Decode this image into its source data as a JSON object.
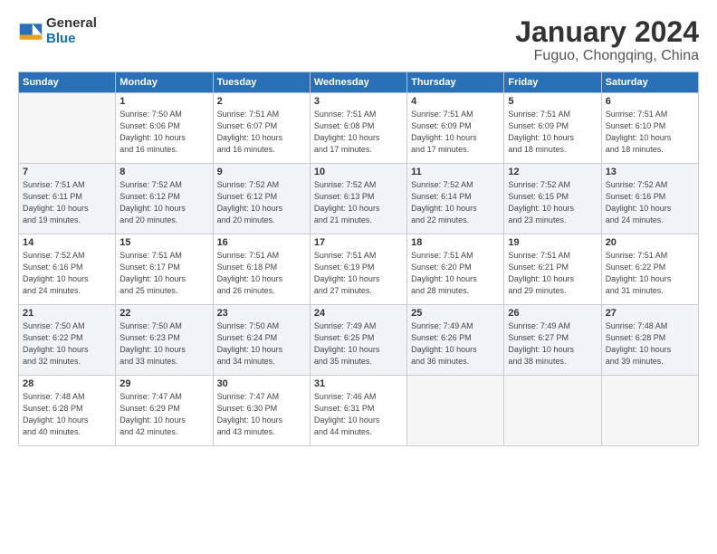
{
  "logo": {
    "text1": "General",
    "text2": "Blue"
  },
  "title": "January 2024",
  "subtitle": "Fuguo, Chongqing, China",
  "days_of_week": [
    "Sunday",
    "Monday",
    "Tuesday",
    "Wednesday",
    "Thursday",
    "Friday",
    "Saturday"
  ],
  "weeks": [
    [
      {
        "day": "",
        "info": ""
      },
      {
        "day": "1",
        "info": "Sunrise: 7:50 AM\nSunset: 6:06 PM\nDaylight: 10 hours\nand 16 minutes."
      },
      {
        "day": "2",
        "info": "Sunrise: 7:51 AM\nSunset: 6:07 PM\nDaylight: 10 hours\nand 16 minutes."
      },
      {
        "day": "3",
        "info": "Sunrise: 7:51 AM\nSunset: 6:08 PM\nDaylight: 10 hours\nand 17 minutes."
      },
      {
        "day": "4",
        "info": "Sunrise: 7:51 AM\nSunset: 6:09 PM\nDaylight: 10 hours\nand 17 minutes."
      },
      {
        "day": "5",
        "info": "Sunrise: 7:51 AM\nSunset: 6:09 PM\nDaylight: 10 hours\nand 18 minutes."
      },
      {
        "day": "6",
        "info": "Sunrise: 7:51 AM\nSunset: 6:10 PM\nDaylight: 10 hours\nand 18 minutes."
      }
    ],
    [
      {
        "day": "7",
        "info": "Sunrise: 7:51 AM\nSunset: 6:11 PM\nDaylight: 10 hours\nand 19 minutes."
      },
      {
        "day": "8",
        "info": "Sunrise: 7:52 AM\nSunset: 6:12 PM\nDaylight: 10 hours\nand 20 minutes."
      },
      {
        "day": "9",
        "info": "Sunrise: 7:52 AM\nSunset: 6:12 PM\nDaylight: 10 hours\nand 20 minutes."
      },
      {
        "day": "10",
        "info": "Sunrise: 7:52 AM\nSunset: 6:13 PM\nDaylight: 10 hours\nand 21 minutes."
      },
      {
        "day": "11",
        "info": "Sunrise: 7:52 AM\nSunset: 6:14 PM\nDaylight: 10 hours\nand 22 minutes."
      },
      {
        "day": "12",
        "info": "Sunrise: 7:52 AM\nSunset: 6:15 PM\nDaylight: 10 hours\nand 23 minutes."
      },
      {
        "day": "13",
        "info": "Sunrise: 7:52 AM\nSunset: 6:16 PM\nDaylight: 10 hours\nand 24 minutes."
      }
    ],
    [
      {
        "day": "14",
        "info": "Sunrise: 7:52 AM\nSunset: 6:16 PM\nDaylight: 10 hours\nand 24 minutes."
      },
      {
        "day": "15",
        "info": "Sunrise: 7:51 AM\nSunset: 6:17 PM\nDaylight: 10 hours\nand 25 minutes."
      },
      {
        "day": "16",
        "info": "Sunrise: 7:51 AM\nSunset: 6:18 PM\nDaylight: 10 hours\nand 26 minutes."
      },
      {
        "day": "17",
        "info": "Sunrise: 7:51 AM\nSunset: 6:19 PM\nDaylight: 10 hours\nand 27 minutes."
      },
      {
        "day": "18",
        "info": "Sunrise: 7:51 AM\nSunset: 6:20 PM\nDaylight: 10 hours\nand 28 minutes."
      },
      {
        "day": "19",
        "info": "Sunrise: 7:51 AM\nSunset: 6:21 PM\nDaylight: 10 hours\nand 29 minutes."
      },
      {
        "day": "20",
        "info": "Sunrise: 7:51 AM\nSunset: 6:22 PM\nDaylight: 10 hours\nand 31 minutes."
      }
    ],
    [
      {
        "day": "21",
        "info": "Sunrise: 7:50 AM\nSunset: 6:22 PM\nDaylight: 10 hours\nand 32 minutes."
      },
      {
        "day": "22",
        "info": "Sunrise: 7:50 AM\nSunset: 6:23 PM\nDaylight: 10 hours\nand 33 minutes."
      },
      {
        "day": "23",
        "info": "Sunrise: 7:50 AM\nSunset: 6:24 PM\nDaylight: 10 hours\nand 34 minutes."
      },
      {
        "day": "24",
        "info": "Sunrise: 7:49 AM\nSunset: 6:25 PM\nDaylight: 10 hours\nand 35 minutes."
      },
      {
        "day": "25",
        "info": "Sunrise: 7:49 AM\nSunset: 6:26 PM\nDaylight: 10 hours\nand 36 minutes."
      },
      {
        "day": "26",
        "info": "Sunrise: 7:49 AM\nSunset: 6:27 PM\nDaylight: 10 hours\nand 38 minutes."
      },
      {
        "day": "27",
        "info": "Sunrise: 7:48 AM\nSunset: 6:28 PM\nDaylight: 10 hours\nand 39 minutes."
      }
    ],
    [
      {
        "day": "28",
        "info": "Sunrise: 7:48 AM\nSunset: 6:28 PM\nDaylight: 10 hours\nand 40 minutes."
      },
      {
        "day": "29",
        "info": "Sunrise: 7:47 AM\nSunset: 6:29 PM\nDaylight: 10 hours\nand 42 minutes."
      },
      {
        "day": "30",
        "info": "Sunrise: 7:47 AM\nSunset: 6:30 PM\nDaylight: 10 hours\nand 43 minutes."
      },
      {
        "day": "31",
        "info": "Sunrise: 7:46 AM\nSunset: 6:31 PM\nDaylight: 10 hours\nand 44 minutes."
      },
      {
        "day": "",
        "info": ""
      },
      {
        "day": "",
        "info": ""
      },
      {
        "day": "",
        "info": ""
      }
    ]
  ]
}
